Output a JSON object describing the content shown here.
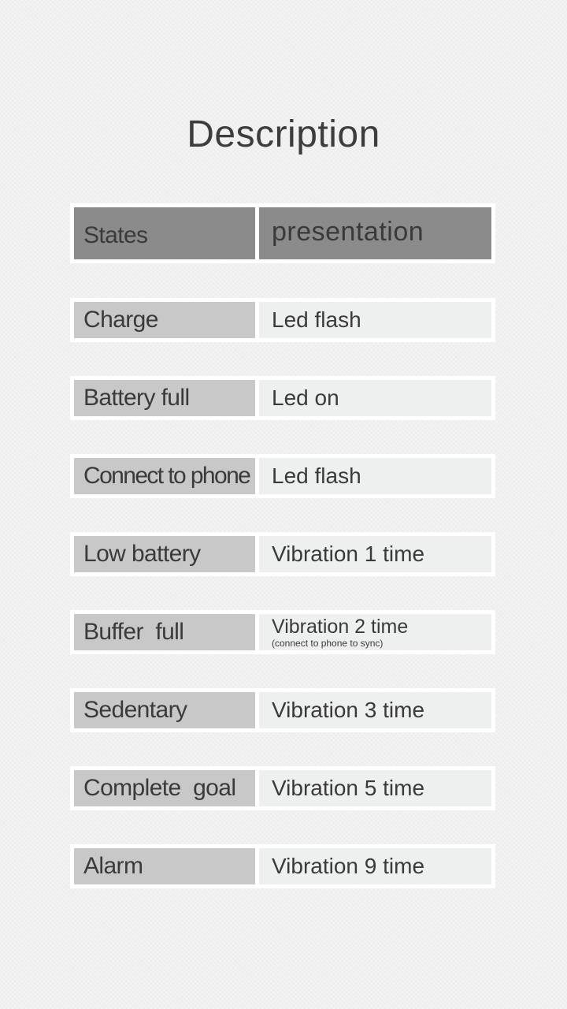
{
  "title": "Description",
  "header": {
    "states": "States",
    "presentation": "presentation"
  },
  "rows": [
    {
      "state": "Charge",
      "presentation": "Led flash"
    },
    {
      "state": "Battery full",
      "presentation": "Led on"
    },
    {
      "state": "Connect to phone",
      "presentation": "Led flash"
    },
    {
      "state": "Low battery",
      "presentation": "Vibration 1 time"
    },
    {
      "state": "Buffer  full",
      "presentation": "Vibration 2 time",
      "note": "(connect to phone to sync)"
    },
    {
      "state": "Sedentary",
      "presentation": "Vibration 3 time"
    },
    {
      "state": "Complete  goal",
      "presentation": "Vibration 5 time"
    },
    {
      "state": "Alarm",
      "presentation": "Vibration 9 time"
    }
  ],
  "colors": {
    "background": "#f0f0f0",
    "header_cell": "#8b8b8b",
    "state_cell": "#c8c8c8",
    "presentation_cell": "#eeefef",
    "text": "#3a3a3a"
  }
}
